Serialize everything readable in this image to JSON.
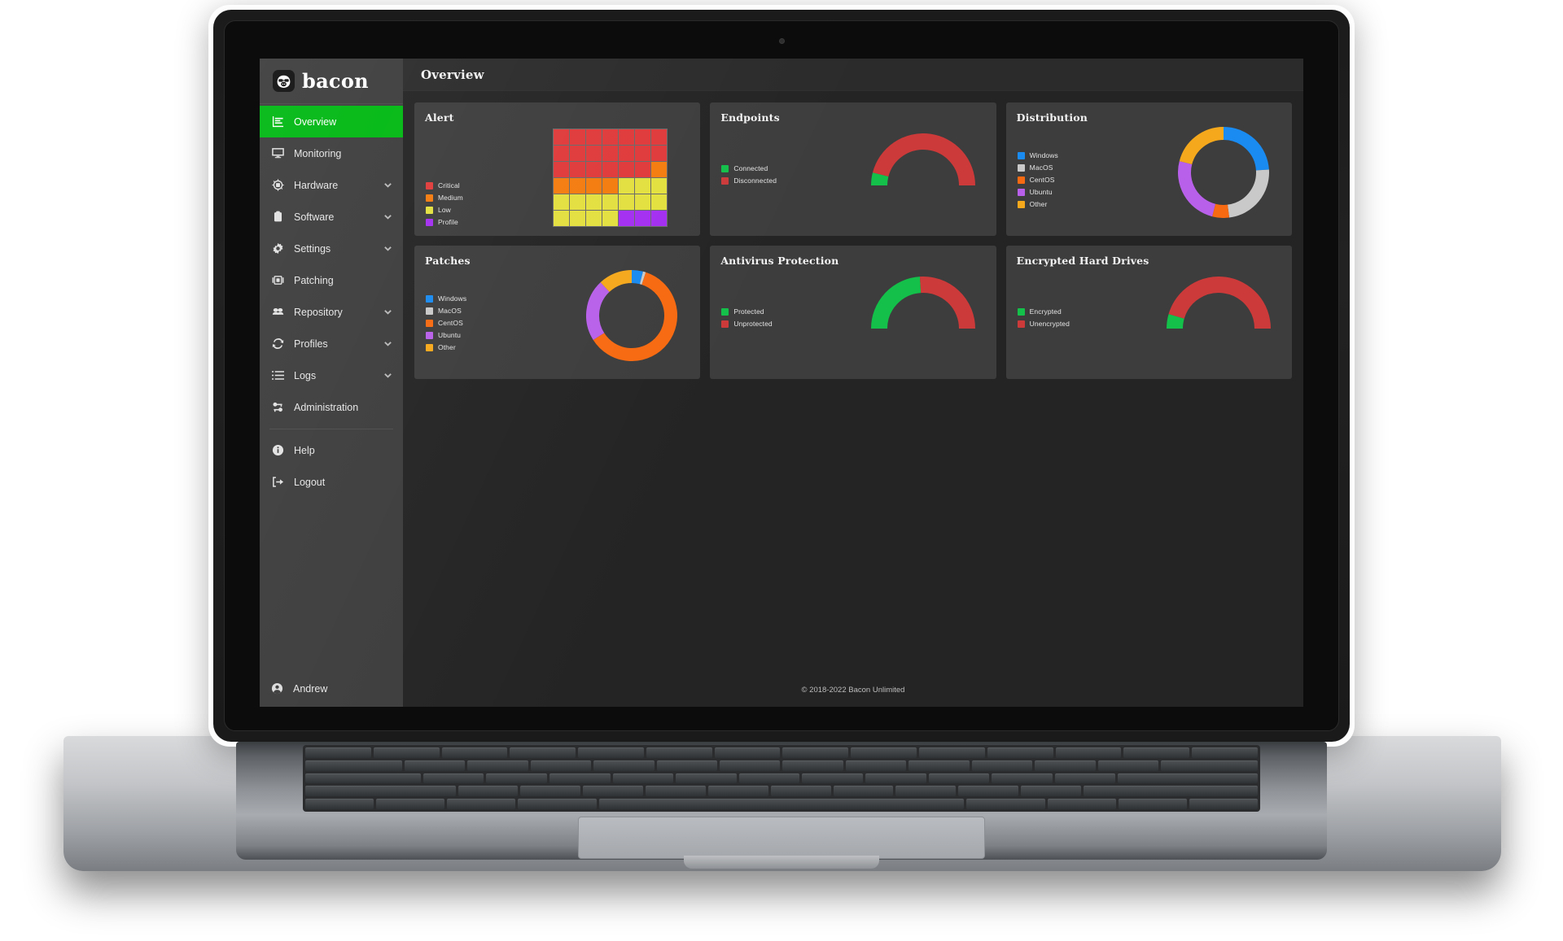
{
  "brand": {
    "name": "bacon",
    "logo_icon": "bacon-pig-logo"
  },
  "header": {
    "title": "Overview"
  },
  "sidebar": {
    "items": [
      {
        "label": "Overview",
        "icon": "bar-chart-icon",
        "active": true,
        "caret": false
      },
      {
        "label": "Monitoring",
        "icon": "monitor-icon",
        "active": false,
        "caret": false
      },
      {
        "label": "Hardware",
        "icon": "cpu-chip-icon",
        "active": false,
        "caret": true
      },
      {
        "label": "Software",
        "icon": "clipboard-icon",
        "active": false,
        "caret": true
      },
      {
        "label": "Settings",
        "icon": "gear-icon",
        "active": false,
        "caret": true
      },
      {
        "label": "Patching",
        "icon": "patch-icon",
        "active": false,
        "caret": false
      },
      {
        "label": "Repository",
        "icon": "repository-icon",
        "active": false,
        "caret": true
      },
      {
        "label": "Profiles",
        "icon": "refresh-icon",
        "active": false,
        "caret": true
      },
      {
        "label": "Logs",
        "icon": "list-icon",
        "active": false,
        "caret": true
      },
      {
        "label": "Administration",
        "icon": "admin-keys-icon",
        "active": false,
        "caret": false
      }
    ],
    "footer_items": [
      {
        "label": "Help",
        "icon": "info-circle-icon"
      },
      {
        "label": "Logout",
        "icon": "logout-icon"
      }
    ],
    "user": {
      "name": "Andrew",
      "icon": "user-circle-icon"
    }
  },
  "footer": {
    "copyright": "© 2018-2022 Bacon Unlimited"
  },
  "colors": {
    "accent_green": "#00b812",
    "critical_red": "#e03b3b",
    "medium_orange": "#f57c0f",
    "low_yellow": "#e3e040",
    "profile_purple": "#a32ff0",
    "windows_blue": "#1a8bf0",
    "macos_gray": "#c9c9c9",
    "centos_orange": "#f76a11",
    "ubuntu_purple": "#b860ea",
    "other_amber": "#f5a81c",
    "gauge_green": "#14c04a",
    "gauge_red": "#cc3a3a",
    "card_bg": "#3d3d3d",
    "app_bg": "#242424"
  },
  "cards": [
    {
      "id": "alert",
      "title": "Alert",
      "legend": [
        {
          "label": "Critical",
          "color": "#e03b3b"
        },
        {
          "label": "Medium",
          "color": "#f57c0f"
        },
        {
          "label": "Low",
          "color": "#e3e040"
        },
        {
          "label": "Profile",
          "color": "#a32ff0"
        }
      ]
    },
    {
      "id": "endpoints",
      "title": "Endpoints",
      "legend": [
        {
          "label": "Connected",
          "color": "#14c04a"
        },
        {
          "label": "Disconnected",
          "color": "#cc3a3a"
        }
      ]
    },
    {
      "id": "distribution",
      "title": "Distribution",
      "legend": [
        {
          "label": "Windows",
          "color": "#1a8bf0"
        },
        {
          "label": "MacOS",
          "color": "#c9c9c9"
        },
        {
          "label": "CentOS",
          "color": "#f76a11"
        },
        {
          "label": "Ubuntu",
          "color": "#b860ea"
        },
        {
          "label": "Other",
          "color": "#f5a81c"
        }
      ]
    },
    {
      "id": "patches",
      "title": "Patches",
      "legend": [
        {
          "label": "Windows",
          "color": "#1a8bf0"
        },
        {
          "label": "MacOS",
          "color": "#c9c9c9"
        },
        {
          "label": "CentOS",
          "color": "#f76a11"
        },
        {
          "label": "Ubuntu",
          "color": "#b860ea"
        },
        {
          "label": "Other",
          "color": "#f5a81c"
        }
      ]
    },
    {
      "id": "antivirus",
      "title": "Antivirus Protection",
      "legend": [
        {
          "label": "Protected",
          "color": "#14c04a"
        },
        {
          "label": "Unprotected",
          "color": "#cc3a3a"
        }
      ]
    },
    {
      "id": "encrypted",
      "title": "Encrypted Hard Drives",
      "legend": [
        {
          "label": "Encrypted",
          "color": "#14c04a"
        },
        {
          "label": "Unencrypted",
          "color": "#cc3a3a"
        }
      ]
    }
  ],
  "chart_data": [
    {
      "id": "alert",
      "type": "heatmap",
      "title": "Alert",
      "rows": 6,
      "cols": 7,
      "categories": [
        "Critical",
        "Medium",
        "Low",
        "Profile"
      ],
      "category_colors": [
        "#e03b3b",
        "#f57c0f",
        "#e3e040",
        "#a32ff0"
      ],
      "cells": [
        [
          "Critical",
          "Critical",
          "Critical",
          "Critical",
          "Critical",
          "Critical",
          "Critical"
        ],
        [
          "Critical",
          "Critical",
          "Critical",
          "Critical",
          "Critical",
          "Critical",
          "Critical"
        ],
        [
          "Critical",
          "Critical",
          "Critical",
          "Critical",
          "Critical",
          "Critical",
          "Medium"
        ],
        [
          "Medium",
          "Medium",
          "Medium",
          "Medium",
          "Low",
          "Low",
          "Low"
        ],
        [
          "Low",
          "Low",
          "Low",
          "Low",
          "Low",
          "Low",
          "Low"
        ],
        [
          "Low",
          "Low",
          "Low",
          "Low",
          "Profile",
          "Profile",
          "Profile"
        ]
      ],
      "counts": {
        "Critical": 20,
        "Medium": 5,
        "Low": 14,
        "Profile": 3
      },
      "legend_position": "left"
    },
    {
      "id": "endpoints",
      "type": "gauge",
      "title": "Endpoints",
      "categories": [
        "Connected",
        "Disconnected"
      ],
      "values": [
        8,
        92
      ],
      "colors": [
        "#14c04a",
        "#cc3a3a"
      ],
      "unit": "%",
      "legend_position": "left"
    },
    {
      "id": "distribution",
      "type": "pie",
      "title": "Distribution",
      "categories": [
        "Windows",
        "MacOS",
        "CentOS",
        "Ubuntu",
        "Other"
      ],
      "values": [
        24,
        24,
        6,
        25,
        21
      ],
      "colors": [
        "#1a8bf0",
        "#c9c9c9",
        "#f76a11",
        "#b860ea",
        "#f5a81c"
      ],
      "donut": true,
      "legend_position": "left"
    },
    {
      "id": "patches",
      "type": "pie",
      "title": "Patches",
      "categories": [
        "Windows",
        "MacOS",
        "CentOS",
        "Ubuntu",
        "Other"
      ],
      "values": [
        4,
        1,
        61,
        22,
        12
      ],
      "colors": [
        "#1a8bf0",
        "#c9c9c9",
        "#f76a11",
        "#b860ea",
        "#f5a81c"
      ],
      "donut": true,
      "legend_position": "left"
    },
    {
      "id": "antivirus",
      "type": "gauge",
      "title": "Antivirus Protection",
      "categories": [
        "Protected",
        "Unprotected"
      ],
      "values": [
        48,
        52
      ],
      "colors": [
        "#14c04a",
        "#cc3a3a"
      ],
      "unit": "%",
      "legend_position": "left"
    },
    {
      "id": "encrypted",
      "type": "gauge",
      "title": "Encrypted Hard Drives",
      "categories": [
        "Encrypted",
        "Unencrypted"
      ],
      "values": [
        9,
        91
      ],
      "colors": [
        "#14c04a",
        "#cc3a3a"
      ],
      "unit": "%",
      "legend_position": "left"
    }
  ]
}
